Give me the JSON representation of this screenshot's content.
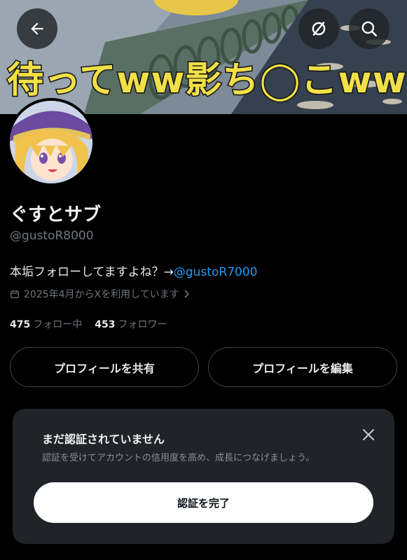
{
  "banner": {
    "text": "待ってww影ち◯こww",
    "back_icon": "arrow-left-icon",
    "hide_icon": "eye-slash-icon",
    "search_icon": "search-icon"
  },
  "profile": {
    "display_name": "ぐすとサブ",
    "handle": "@gustoR8000",
    "bio_text": "本垢フォローしてますよね？→",
    "bio_mention": "@gustoR7000",
    "joined": "2025年4月からXを利用しています",
    "following_count": "475",
    "following_label": "フォロー中",
    "followers_count": "453",
    "followers_label": "フォロワー"
  },
  "actions": {
    "share_label": "プロフィールを共有",
    "edit_label": "プロフィールを編集"
  },
  "verify_card": {
    "title": "まだ認証されていません",
    "description": "認証を受けてアカウントの信用度を高め、成長につなげましょう。",
    "button_label": "認証を完了"
  },
  "colors": {
    "background": "#000000",
    "accent": "#1d9bf0",
    "banner_text": "#f1df49",
    "card": "#202327"
  }
}
